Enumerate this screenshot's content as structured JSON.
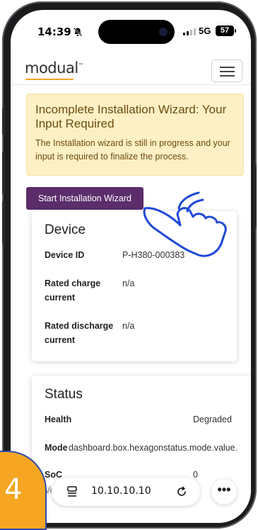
{
  "status_bar": {
    "time": "14:39",
    "network": "5G",
    "battery": "57"
  },
  "header": {
    "logo": "modual",
    "logo_tm": "™"
  },
  "alert": {
    "title": "Incomplete Installation Wizard: Your Input Required",
    "text": "The Installation wizard is still in progress and your input is required to finalize the process."
  },
  "start_button": "Start Installation Wizard",
  "device": {
    "title": "Device",
    "rows": [
      {
        "label": "Device ID",
        "value": "P-H380-000383"
      },
      {
        "label": "Rated charge current",
        "value": "n/a"
      },
      {
        "label": "Rated discharge current",
        "value": "n/a"
      }
    ]
  },
  "status": {
    "title": "Status",
    "health_label": "Health",
    "health_value": "Degraded",
    "mode_label": "Mode",
    "mode_value": "dashboard.box.hexagonstatus.mode.value.",
    "soc_label": "SoC",
    "soc_value": "0",
    "voltage_label": "Voltage"
  },
  "browser": {
    "url": "10.10.10.10",
    "more": "•••",
    "back": "‹"
  },
  "step_badge": "4",
  "icons": [
    "bell-slash-icon",
    "signal-icon",
    "battery-icon",
    "hamburger-menu-icon",
    "pointing-hand-icon",
    "tab-lines-icon",
    "reload-icon",
    "more-icon",
    "back-icon"
  ]
}
